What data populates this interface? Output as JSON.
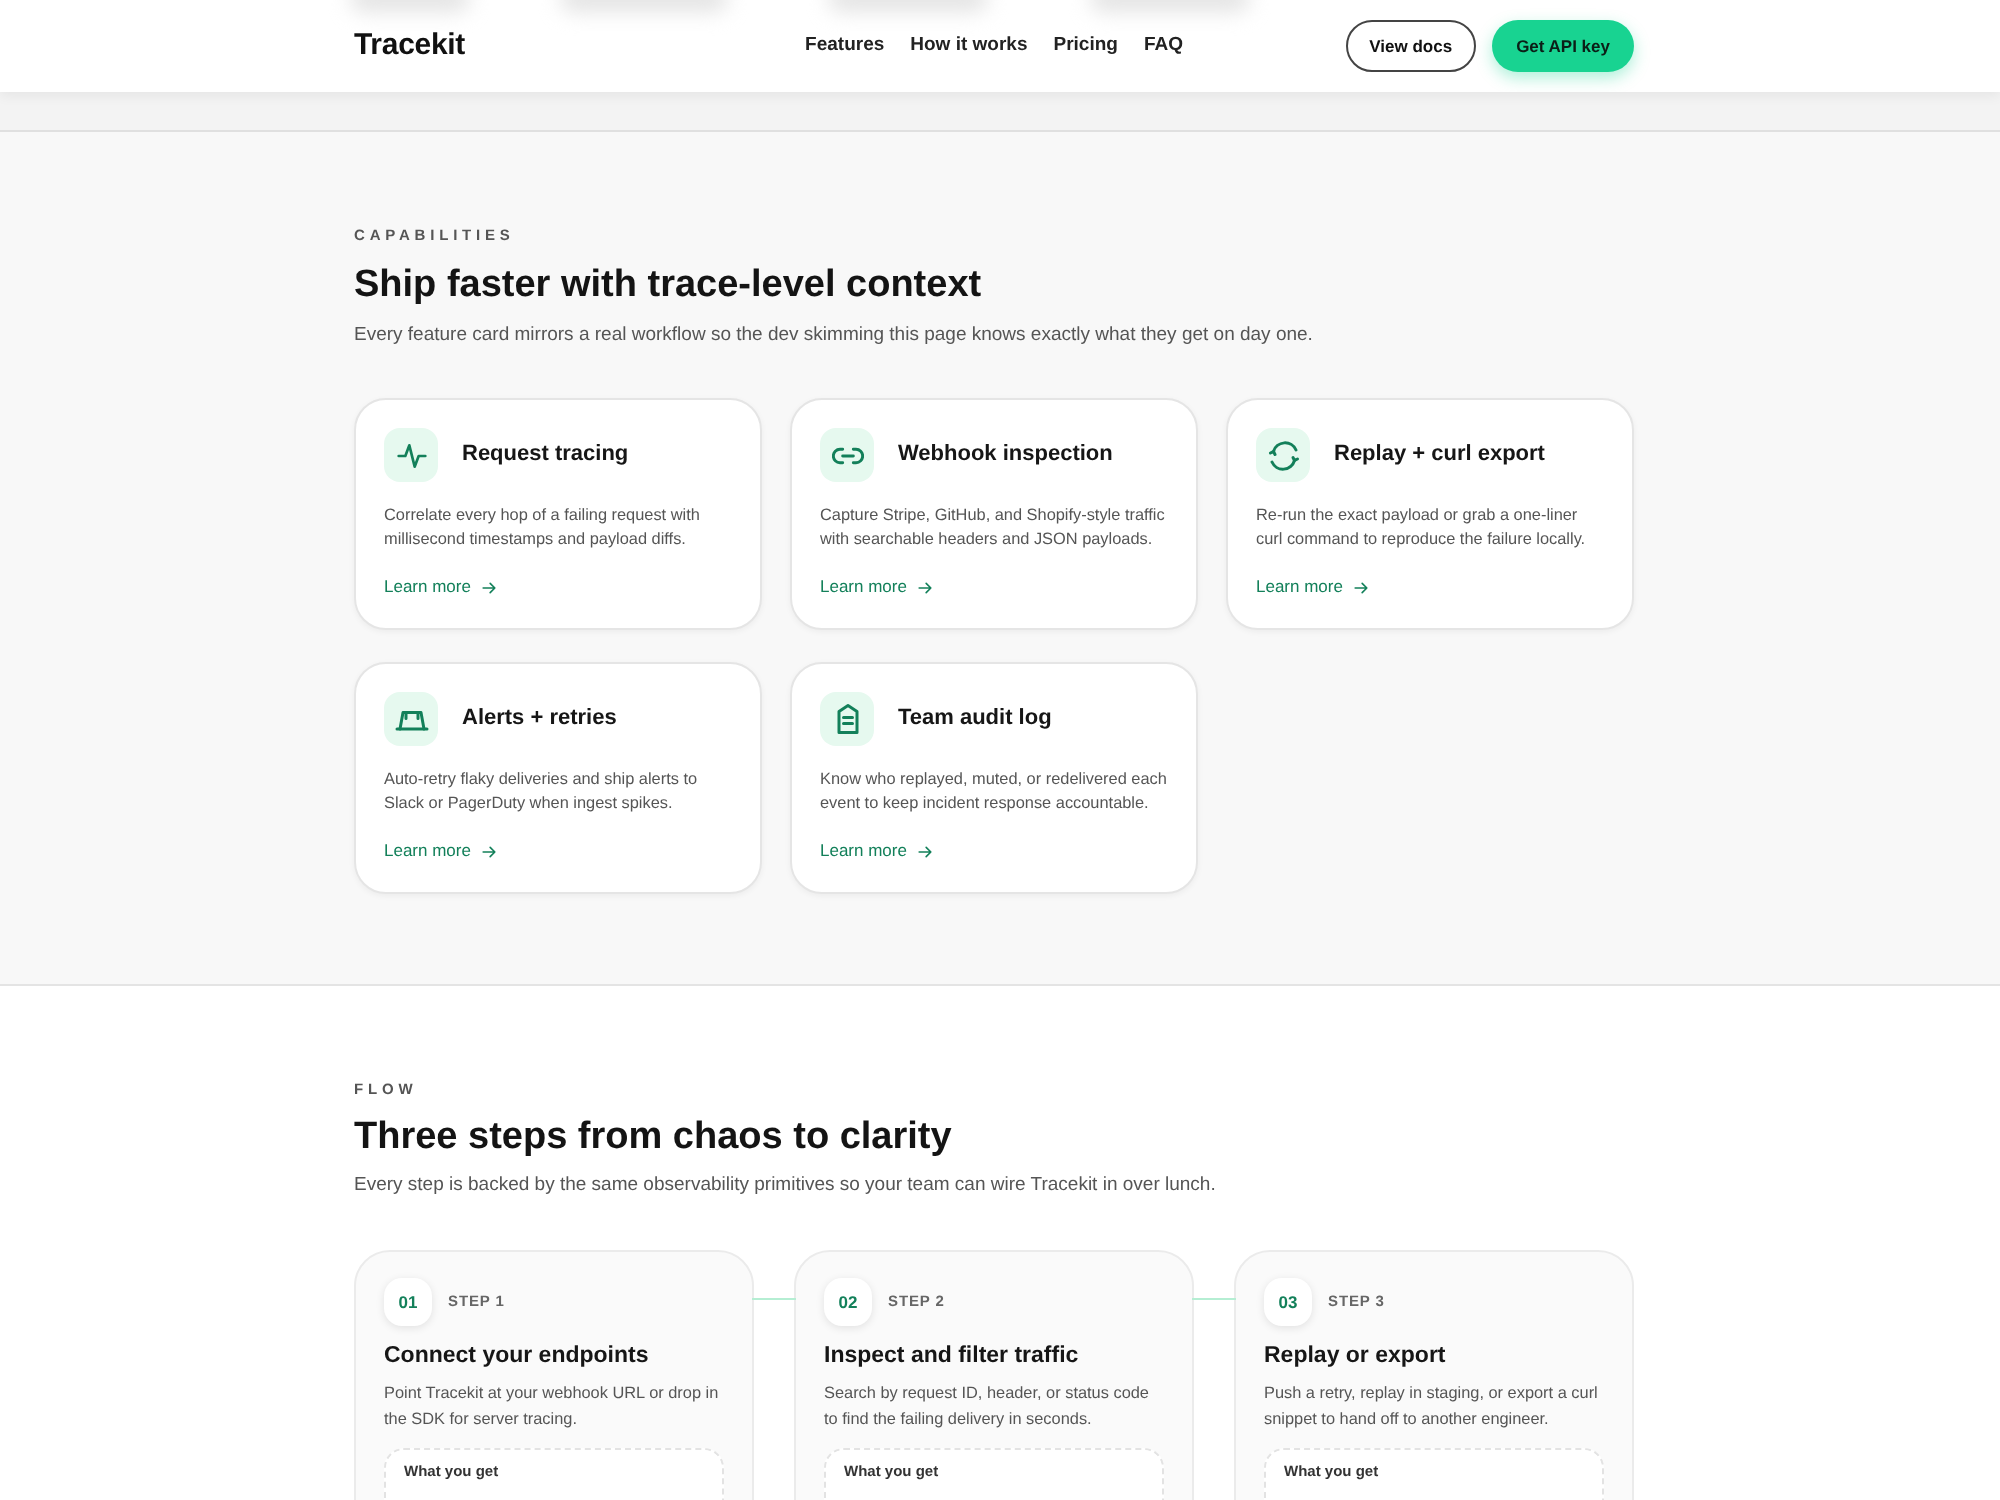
{
  "header": {
    "logo": "Tracekit",
    "nav": [
      {
        "label": "Features"
      },
      {
        "label": "How it works"
      },
      {
        "label": "Pricing"
      },
      {
        "label": "FAQ"
      }
    ],
    "buttons": [
      {
        "label": "View docs",
        "kind": "secondary"
      },
      {
        "label": "Get API key",
        "kind": "primary"
      }
    ]
  },
  "capabilities": {
    "eyebrow": "CAPABILITIES",
    "title": "Ship faster with trace-level context",
    "subtitle": "Every feature card mirrors a real workflow so the dev skimming this page knows exactly what they get on day one.",
    "cards": [
      {
        "title": "Request tracing",
        "description": "Correlate every hop of a failing request with millisecond timestamps and payload diffs.",
        "link": "Learn more"
      },
      {
        "title": "Webhook inspection",
        "description": "Capture Stripe, GitHub, and Shopify-style traffic with searchable headers and JSON payloads.",
        "link": "Learn more"
      },
      {
        "title": "Replay + curl export",
        "description": "Re-run the exact payload or grab a one-liner curl command to reproduce the failure locally.",
        "link": "Learn more"
      },
      {
        "title": "Alerts + retries",
        "description": "Auto-retry flaky deliveries and ship alerts to Slack or PagerDuty when ingest spikes.",
        "link": "Learn more"
      },
      {
        "title": "Team audit log",
        "description": "Know who replayed, muted, or redelivered each event to keep incident response accountable.",
        "link": "Learn more"
      }
    ]
  },
  "flow": {
    "eyebrow": "FLOW",
    "title": "Three steps from chaos to clarity",
    "subtitle": "Every step is backed by the same observability primitives so your team can wire Tracekit in over lunch.",
    "steps": [
      {
        "number": "01",
        "label": "STEP 1",
        "title": "Connect your endpoints",
        "description": "Point Tracekit at your webhook URL or drop in the SDK for server tracing.",
        "box_title": "What you get"
      },
      {
        "number": "02",
        "label": "STEP 2",
        "title": "Inspect and filter traffic",
        "description": "Search by request ID, header, or status code to find the failing delivery in seconds.",
        "box_title": "What you get"
      },
      {
        "number": "03",
        "label": "STEP 3",
        "title": "Replay or export",
        "description": "Push a retry, replay in staging, or export a curl snippet to hand off to another engineer.",
        "box_title": "What you get"
      }
    ]
  }
}
